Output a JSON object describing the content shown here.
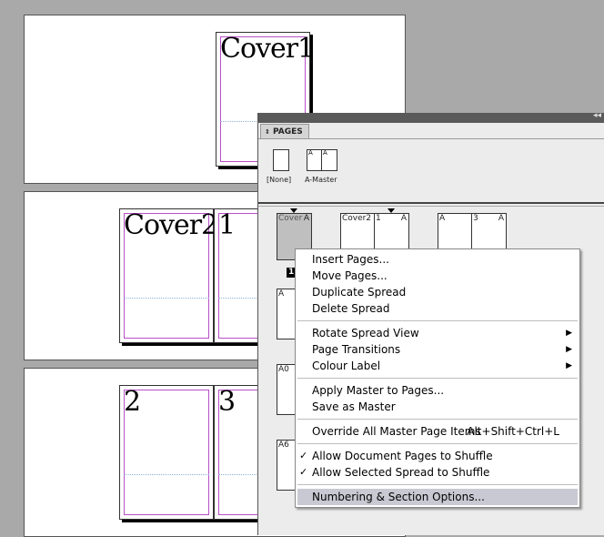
{
  "canvas": {
    "spread1_pages": [
      "Cover1"
    ],
    "spread2_pages": [
      "Cover2",
      "1"
    ],
    "spread3_pages": [
      "2",
      "3"
    ]
  },
  "panel": {
    "tab_label": "PAGES",
    "collapse_glyph": "◂◂",
    "masters": [
      {
        "label": "[None]",
        "prefix": ""
      },
      {
        "label": "A-Master",
        "prefix": "A"
      }
    ],
    "thumbs": {
      "cover": "Cover",
      "cover_prefix": "A",
      "cover2": "Cover2",
      "page_1": "1",
      "page_3": "3",
      "a": "A",
      "row_labels": [
        "A",
        "A0",
        "A6"
      ],
      "selected_number": "1"
    }
  },
  "menu": {
    "items": [
      {
        "label": "Insert Pages..."
      },
      {
        "label": "Move Pages..."
      },
      {
        "label": "Duplicate Spread"
      },
      {
        "label": "Delete Spread"
      },
      {
        "label": "Rotate Spread View"
      },
      {
        "label": "Page Transitions"
      },
      {
        "label": "Colour Label"
      },
      {
        "label": "Apply Master to Pages..."
      },
      {
        "label": "Save as Master"
      },
      {
        "label": "Override All Master Page Items",
        "shortcut": "Alt+Shift+Ctrl+L"
      },
      {
        "label": "Allow Document Pages to Shuffle",
        "check": "✓"
      },
      {
        "label": "Allow Selected Spread to Shuffle",
        "check": "✓"
      },
      {
        "label": "Numbering & Section Options..."
      }
    ],
    "submenu_arrow": "▶"
  },
  "colors": {
    "margin_guide": "#b84fc7",
    "highlight": "#c9c9d3"
  }
}
